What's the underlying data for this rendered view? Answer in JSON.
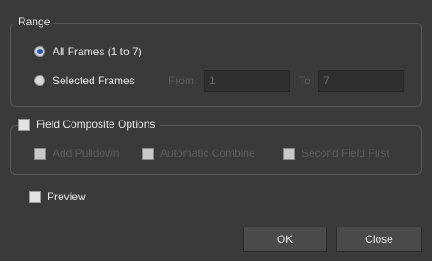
{
  "range": {
    "title": "Range",
    "all_frames_label": "All Frames (1 to 7)",
    "selected_frames_label": "Selected Frames",
    "from_label": "From",
    "from_value": "1",
    "to_label": "To",
    "to_value": "7"
  },
  "field_composite": {
    "title": "Field Composite Options",
    "add_pulldown_label": "Add Pulldown",
    "automatic_combine_label": "Automatic Combine",
    "second_field_first_label": "Second Field First"
  },
  "preview_label": "Preview",
  "buttons": {
    "ok_label": "OK",
    "close_label": "Close"
  },
  "colors": {
    "background": "#3a3a3a",
    "radio_selected": "#2a56b8",
    "disabled_text": "#5f5f5f"
  }
}
